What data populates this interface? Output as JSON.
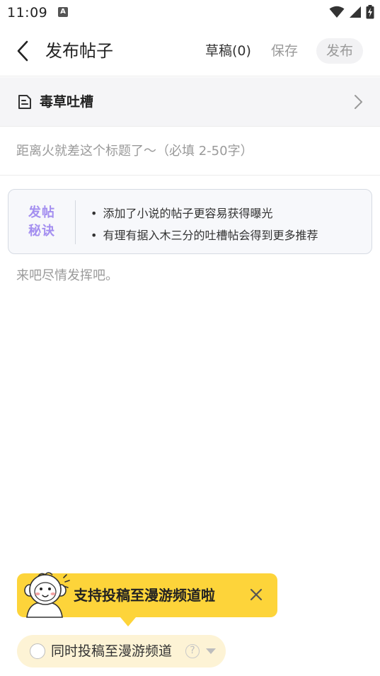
{
  "status_bar": {
    "time": "11:09",
    "notification_icon_letter": "A",
    "icons": [
      "wifi-icon",
      "signal-icon",
      "battery-charging-icon"
    ]
  },
  "header": {
    "back_icon": "chevron-left-icon",
    "title": "发布帖子",
    "draft_label": "草稿(0)",
    "save_label": "保存",
    "publish_label": "发布"
  },
  "category": {
    "icon": "document-icon",
    "label": "毒草吐槽",
    "chevron_icon": "chevron-right-icon"
  },
  "title_field": {
    "placeholder": "距离火就差这个标题了～（必填 2-50字）",
    "value": ""
  },
  "tips": {
    "badge_line1": "发帖",
    "badge_line2": "秘诀",
    "items": [
      "添加了小说的帖子更容易获得曝光",
      "有理有据入木三分的吐槽帖会得到更多推荐"
    ]
  },
  "body_field": {
    "placeholder": "来吧尽情发挥吧。",
    "value": ""
  },
  "promo": {
    "mascot_icon": "monkey-mascot-icon",
    "text": "支持投稿至漫游频道啦",
    "close_icon": "close-icon"
  },
  "submit_channel": {
    "label": "同时投稿至漫游频道",
    "checked": false,
    "help_icon": "question-circle-icon",
    "dropdown_icon": "triangle-down-icon"
  },
  "colors": {
    "accent_purple": "#a48ff0",
    "promo_yellow": "#fdd43a",
    "toggle_bg": "#fdf3d5",
    "category_bg": "#f5f5f7"
  }
}
